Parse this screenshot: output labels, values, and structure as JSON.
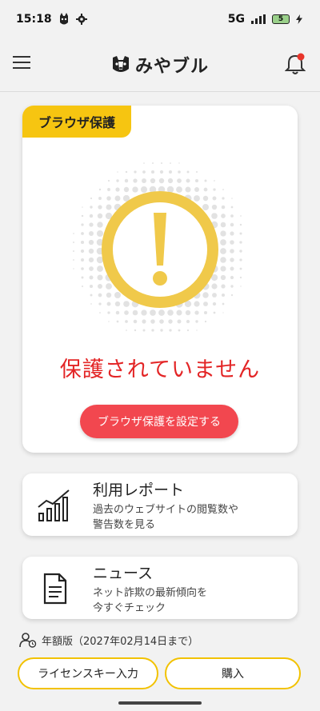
{
  "status_bar": {
    "time": "15:18",
    "network": "5G",
    "battery": "5",
    "icons": [
      "dog-notification-icon",
      "gear-icon",
      "signal-icon",
      "battery-icon",
      "charging-bolt-icon"
    ]
  },
  "header": {
    "app_name": "みやブル",
    "menu_icon": "hamburger-menu-icon",
    "notification_icon": "bell-icon"
  },
  "protection_card": {
    "tag_label": "ブラウザ保護",
    "warning_icon": "exclamation-warning-icon",
    "status_text": "保護されていません",
    "setup_button_label": "ブラウザ保護を設定する",
    "status_color": "#e32526",
    "accent_color": "#f6c511"
  },
  "report_card": {
    "title": "利用レポート",
    "desc_line1": "過去のウェブサイトの閲覧数や",
    "desc_line2": "警告数を見る",
    "icon": "bar-chart-icon"
  },
  "news_card": {
    "title": "ニュース",
    "desc_line1": "ネット詐欺の最新傾向を",
    "desc_line2": "今すぐチェック",
    "icon": "document-icon"
  },
  "license": {
    "plan_text": "年額版（2027年02月14日まで）",
    "icon": "user-clock-icon"
  },
  "buttons": {
    "license_key_label": "ライセンスキー入力",
    "buy_label": "購入"
  }
}
